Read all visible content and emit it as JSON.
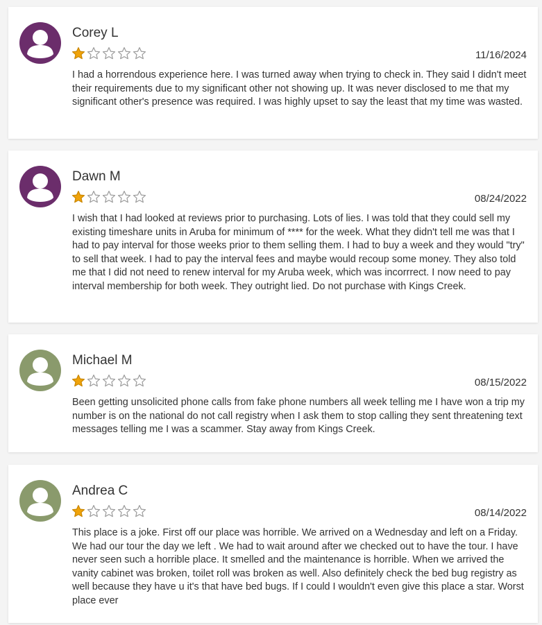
{
  "colors": {
    "avatar_purple": "#6b2d6b",
    "avatar_green": "#8a9a6c",
    "star_filled": "#f0a30a",
    "star_empty": "#9a9a9a"
  },
  "reviews": [
    {
      "name": "Corey L",
      "rating": 1,
      "max_rating": 5,
      "date": "11/16/2024",
      "avatar_color": "#6b2d6b",
      "text": "I had a horrendous experience here. I was turned away when trying to check in. They said I didn't meet their requirements due to my significant other not showing up. It was never disclosed to me that my significant other's presence was required. I was highly upset to say the least that my time was wasted."
    },
    {
      "name": "Dawn M",
      "rating": 1,
      "max_rating": 5,
      "date": "08/24/2022",
      "avatar_color": "#6b2d6b",
      "text": "I wish that I had looked at reviews prior to purchasing. Lots of lies. I was told that they could sell my existing timeshare units in Aruba for minimum of **** for the week. What they didn't tell me was that I had to pay interval for those weeks prior to them selling them. I had to buy a week and they would \"try\" to sell that week. I had to pay the interval fees and maybe would recoup some money. They also told me that I did not need to renew interval for my Aruba week, which was incorrrect. I now need to pay interval membership for both week. They outright lied. Do not purchase with Kings Creek."
    },
    {
      "name": "Michael M",
      "rating": 1,
      "max_rating": 5,
      "date": "08/15/2022",
      "avatar_color": "#8a9a6c",
      "text": "Been getting unsolicited phone calls from fake phone numbers all week telling me I have won a trip my number is on the national do not call registry when I ask them to stop calling they sent threatening text messages telling me I was a scammer. Stay away from Kings Creek."
    },
    {
      "name": "Andrea C",
      "rating": 1,
      "max_rating": 5,
      "date": "08/14/2022",
      "avatar_color": "#8a9a6c",
      "text": "This place is a joke. First off our place was horrible. We arrived on a Wednesday and left on a Friday. We had our tour the day we left . We had to wait around after we checked out to have the tour. I have never seen such a horrible place. It smelled and the maintenance is horrible. When we arrived the vanity cabinet was broken, toilet roll was broken as well. Also definitely check the bed bug registry as well because they have u it's that have bed bugs. If I could I wouldn't even give this place a star. Worst place ever"
    }
  ]
}
